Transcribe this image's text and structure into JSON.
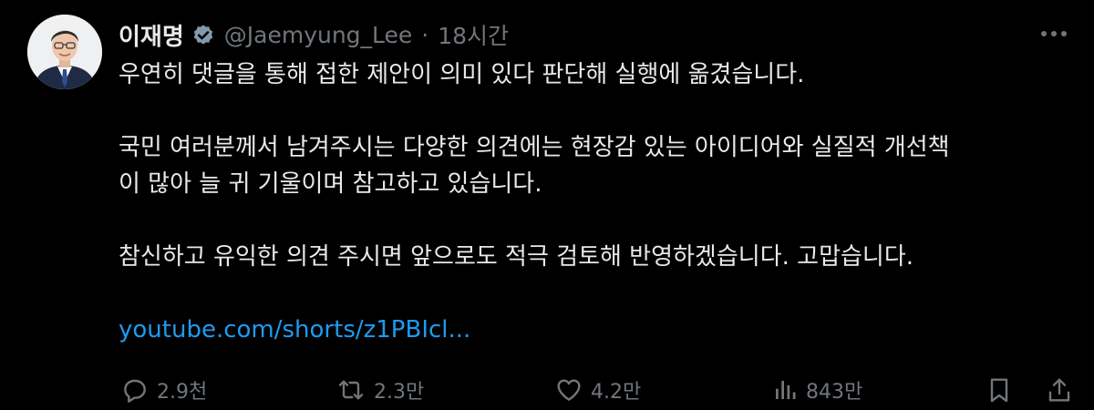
{
  "author": {
    "name": "이재명",
    "handle": "@Jaemyung_Lee",
    "separator": "·",
    "time": "18시간"
  },
  "tweet": {
    "paragraphs": [
      [
        "우연히 댓글을 통해 접한 제안이 의미 있다 판단해 실행에 옮겼습니다."
      ],
      [
        "국민 여러분께서 남겨주시는 다양한 의견에는 현장감 있는 아이디어와 실질적 개선책",
        "이 많아 늘 귀 기울이며 참고하고 있습니다."
      ],
      [
        "참신하고 유익한 의견 주시면 앞으로도 적극 검토해 반영하겠습니다. 고맙습니다."
      ]
    ],
    "link": "youtube.com/shorts/z1PBIcl..."
  },
  "actions": {
    "reply_count": "2.9천",
    "retweet_count": "2.3만",
    "like_count": "4.2만",
    "view_count": "843만"
  },
  "icons": {
    "verified": "verified-badge-icon",
    "more": "more-dots-icon",
    "reply": "reply-icon",
    "retweet": "retweet-icon",
    "like": "heart-icon",
    "views": "views-bar-chart-icon",
    "bookmark": "bookmark-icon",
    "share": "share-icon"
  },
  "colors": {
    "background": "#000000",
    "text": "#e7e9ea",
    "muted": "#71767b",
    "link": "#1d9bf0"
  }
}
